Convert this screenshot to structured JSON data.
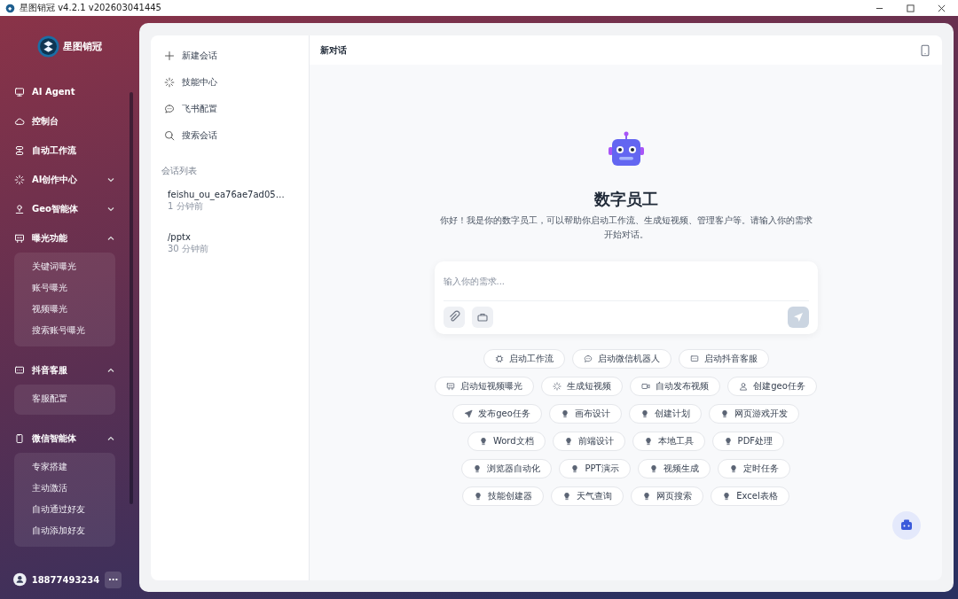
{
  "window": {
    "title": "星图销冠 v4.2.1 v202603041445"
  },
  "sidebar": {
    "brand": "星图销冠",
    "items": [
      {
        "label": "AI Agent"
      },
      {
        "label": "控制台"
      },
      {
        "label": "自动工作流"
      },
      {
        "label": "AI创作中心",
        "expanded": false
      },
      {
        "label": "Geo智能体",
        "expanded": false
      },
      {
        "label": "曝光功能",
        "expanded": true,
        "children": [
          {
            "label": "关键词曝光"
          },
          {
            "label": "账号曝光"
          },
          {
            "label": "视频曝光"
          },
          {
            "label": "搜索账号曝光"
          }
        ]
      },
      {
        "label": "抖音客服",
        "expanded": true,
        "children": [
          {
            "label": "客服配置"
          }
        ]
      },
      {
        "label": "微信智能体",
        "expanded": true,
        "children": [
          {
            "label": "专家搭建"
          },
          {
            "label": "主动激活"
          },
          {
            "label": "自动通过好友"
          },
          {
            "label": "自动添加好友"
          }
        ]
      }
    ],
    "user": {
      "name": "18877493234",
      "more": "···"
    }
  },
  "conversations": {
    "actions": [
      {
        "label": "新建会话"
      },
      {
        "label": "技能中心"
      },
      {
        "label": "飞书配置"
      },
      {
        "label": "搜索会话"
      }
    ],
    "list_title": "会话列表",
    "items": [
      {
        "title": "feishu_ou_ea76ae7ad05…",
        "time": "1 分钟前"
      },
      {
        "title": "/pptx",
        "time": "30 分钟前"
      }
    ]
  },
  "chat": {
    "title": "新对话",
    "heading": "数字员工",
    "intro": "你好！我是你的数字员工，可以帮助你启动工作流、生成短视频、管理客户等。请输入你的需求开始对话。",
    "input": {
      "placeholder": "输入你的需求..."
    },
    "chip_rows": [
      [
        "启动工作流",
        "启动微信机器人",
        "启动抖音客服"
      ],
      [
        "启动短视频曝光",
        "生成短视频",
        "自动发布视频",
        "创建geo任务"
      ],
      [
        "发布geo任务",
        "画布设计",
        "创建计划",
        "网页游戏开发"
      ],
      [
        "Word文档",
        "前端设计",
        "本地工具",
        "PDF处理"
      ],
      [
        "浏览器自动化",
        "PPT演示",
        "视频生成",
        "定时任务"
      ],
      [
        "技能创建器",
        "天气查询",
        "网页搜索",
        "Excel表格"
      ]
    ]
  }
}
